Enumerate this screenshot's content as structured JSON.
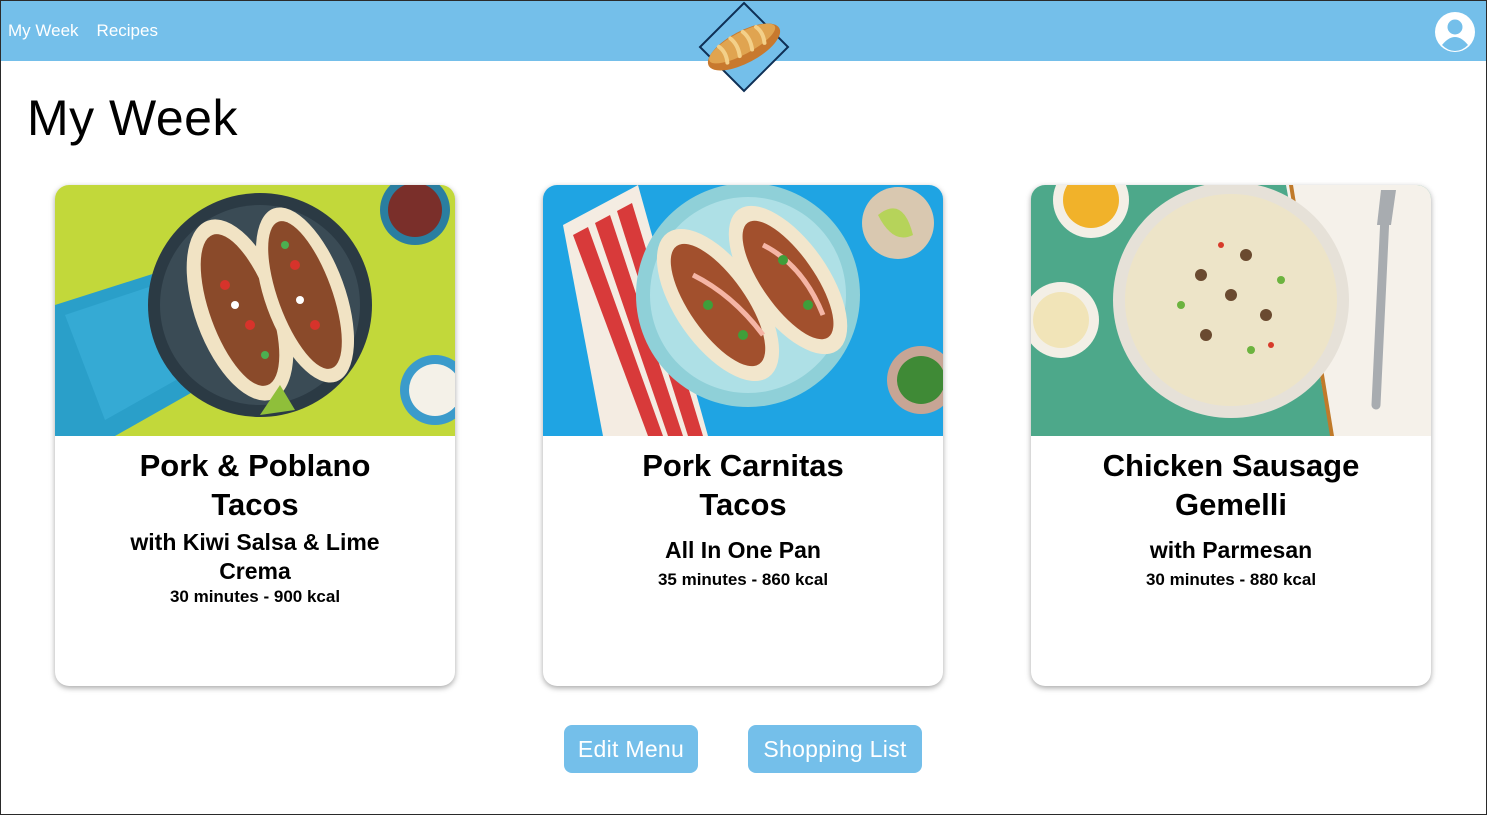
{
  "nav": {
    "links": [
      "My Week",
      "Recipes"
    ],
    "logo_icon": "bread-loaf-logo-icon",
    "avatar_icon": "user-avatar-icon",
    "bar_color": "#74bfea"
  },
  "page": {
    "title": "My Week"
  },
  "recipes": [
    {
      "title_line1": "Pork & Poblano",
      "title_line2": "Tacos",
      "subtitle_line1": "with Kiwi Salsa & Lime",
      "subtitle_line2": "Crema",
      "meta": "30 minutes - 900 kcal",
      "image": "pork-poblano-tacos-photo"
    },
    {
      "title_line1": "Pork Carnitas",
      "title_line2": "Tacos",
      "subtitle_line1": "All In One Pan",
      "subtitle_line2": "",
      "meta": "35 minutes - 860 kcal",
      "image": "pork-carnitas-tacos-photo"
    },
    {
      "title_line1": "Chicken Sausage",
      "title_line2": "Gemelli",
      "subtitle_line1": "with Parmesan",
      "subtitle_line2": "",
      "meta": "30 minutes - 880 kcal",
      "image": "chicken-sausage-gemelli-photo"
    }
  ],
  "actions": {
    "edit_menu": "Edit Menu",
    "shopping_list": "Shopping List"
  }
}
